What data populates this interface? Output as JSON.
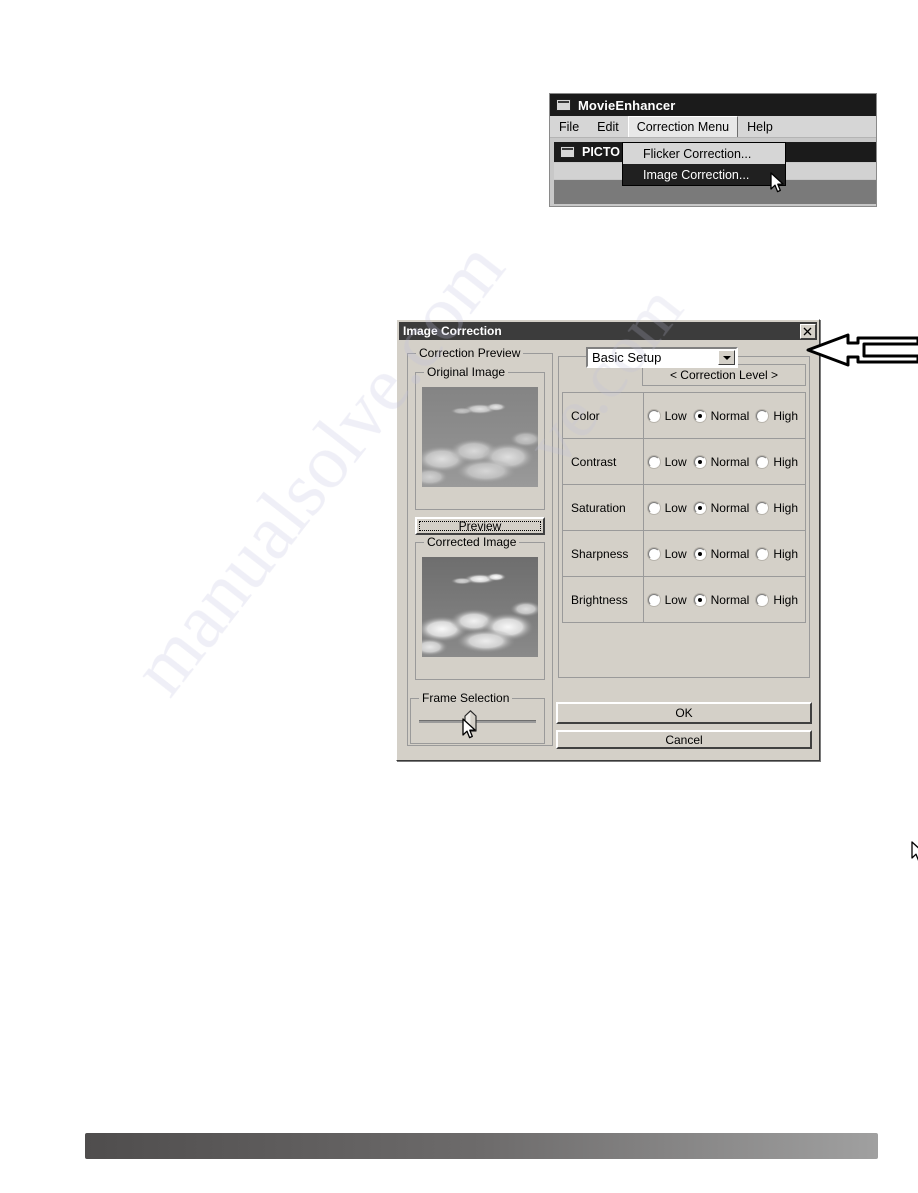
{
  "movie_window": {
    "title": "MovieEnhancer",
    "title_icon": "window-box-icon",
    "menubar": [
      {
        "label": "File",
        "open": false
      },
      {
        "label": "Edit",
        "open": false
      },
      {
        "label": "Correction Menu",
        "open": true
      },
      {
        "label": "Help",
        "open": false
      }
    ],
    "child_window": {
      "title": "PICTO",
      "title_icon": "window-box-icon"
    },
    "dropdown": {
      "items": [
        {
          "label": "Flicker Correction...",
          "highlighted": false
        },
        {
          "label": "Image Correction...",
          "highlighted": true
        }
      ]
    }
  },
  "dialog": {
    "title": "Image Correction",
    "close_label": "✕",
    "preview_group": {
      "label": "Correction Preview",
      "original_group_label": "Original Image",
      "corrected_group_label": "Corrected Image",
      "preview_button_label": "Preview"
    },
    "frame_selection": {
      "label": "Frame Selection",
      "slider_position_percent": 50
    },
    "setup_combo": {
      "value": "Basic Setup",
      "arrow_icon": "chevron-down-icon"
    },
    "correction_level_header": "< Correction Level >",
    "level_options": [
      "Low",
      "Normal",
      "High"
    ],
    "rows": [
      {
        "name": "Color",
        "selected": "Normal"
      },
      {
        "name": "Contrast",
        "selected": "Normal"
      },
      {
        "name": "Saturation",
        "selected": "Normal"
      },
      {
        "name": "Sharpness",
        "selected": "Normal"
      },
      {
        "name": "Brightness",
        "selected": "Normal"
      }
    ],
    "ok_label": "OK",
    "cancel_label": "Cancel"
  },
  "annotation": {
    "arrow_icon": "left-pointing-callout-arrow"
  },
  "colors": {
    "window_face": "#d4d0c8",
    "titlebar_dark": "#1b1b1b",
    "dialog_titlebar": "#3c3c3c",
    "highlight_menu": "#202020",
    "footer_gradient_start": "#4f4d4d",
    "footer_gradient_end": "#a0a0a0"
  }
}
